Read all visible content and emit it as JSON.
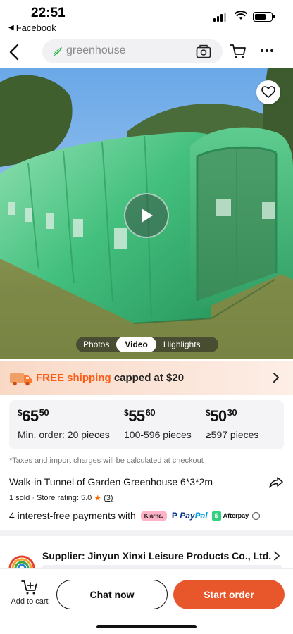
{
  "status_bar": {
    "time": "22:51",
    "back_app": "Facebook"
  },
  "search": {
    "query": "greenhouse"
  },
  "media": {
    "tabs": [
      "Photos",
      "Video",
      "Highlights"
    ],
    "active_tab": "Video"
  },
  "shipping": {
    "free": "FREE shipping",
    "rest": " capped at $20"
  },
  "pricing": [
    {
      "currency": "$",
      "whole": "65",
      "cents": "50",
      "qty": "Min. order: 20 pieces"
    },
    {
      "currency": "$",
      "whole": "55",
      "cents": "60",
      "qty": "100-596 pieces"
    },
    {
      "currency": "$",
      "whole": "50",
      "cents": "30",
      "qty": "≥597 pieces"
    }
  ],
  "tax_note": "*Taxes and import charges will be calculated at checkout",
  "product": {
    "title": "Walk-in Tunnel of Garden Greenhouse 6*3*2m",
    "sold": "1 sold",
    "rating_prefix": "Store rating: 5.0",
    "rating_count": "(3)"
  },
  "payments": {
    "text": "4 interest-free payments with",
    "klarna": "Klarna.",
    "paypal_a": "Pay",
    "paypal_b": "Pal",
    "afterpay": "Afterpay"
  },
  "supplier": {
    "label": "Supplier:",
    "name": "Jinyun Xinxi Leisure Products Co., Ltd."
  },
  "bottom": {
    "add_to_cart": "Add to cart",
    "chat": "Chat now",
    "start": "Start order"
  },
  "colors": {
    "accent": "#e8572c",
    "free_shipping": "#ff5a14",
    "greenhouse": "#3cb878"
  },
  "icons": [
    "back-arrow-icon",
    "leaf-icon",
    "camera-icon",
    "cart-icon",
    "more-icon",
    "heart-icon",
    "play-icon",
    "truck-icon",
    "chevron-right-icon",
    "share-icon",
    "star-icon",
    "info-icon",
    "add-cart-icon"
  ]
}
